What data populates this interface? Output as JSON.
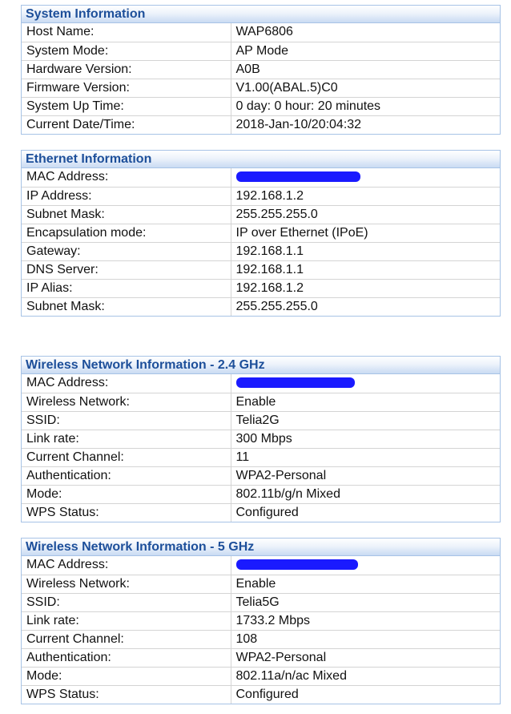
{
  "system": {
    "title": "System Information",
    "rows": [
      {
        "label": "Host Name:",
        "value": "WAP6806"
      },
      {
        "label": "System Mode:",
        "value": "AP Mode"
      },
      {
        "label": "Hardware Version:",
        "value": "A0B"
      },
      {
        "label": "Firmware Version:",
        "value": "V1.00(ABAL.5)C0"
      },
      {
        "label": "System Up Time:",
        "value": "0 day: 0 hour: 20 minutes"
      },
      {
        "label": "Current Date/Time:",
        "value": "2018-Jan-10/20:04:32"
      }
    ]
  },
  "ethernet": {
    "title": "Ethernet Information",
    "mac_label": "MAC Address:",
    "rows": [
      {
        "label": "IP Address:",
        "value": "192.168.1.2"
      },
      {
        "label": "Subnet Mask:",
        "value": "255.255.255.0"
      },
      {
        "label": "Encapsulation mode:",
        "value": "IP over Ethernet (IPoE)"
      },
      {
        "label": "Gateway:",
        "value": "192.168.1.1"
      },
      {
        "label": "DNS Server:",
        "value": "192.168.1.1"
      },
      {
        "label": "IP Alias:",
        "value": "192.168.1.2"
      },
      {
        "label": "Subnet Mask:",
        "value": "255.255.255.0"
      }
    ]
  },
  "wifi24": {
    "title": "Wireless Network Information - 2.4 GHz",
    "mac_label": "MAC Address:",
    "rows": [
      {
        "label": "Wireless Network:",
        "value": "Enable"
      },
      {
        "label": "SSID:",
        "value": "Telia2G"
      },
      {
        "label": "Link rate:",
        "value": "300 Mbps"
      },
      {
        "label": "Current Channel:",
        "value": "11"
      },
      {
        "label": "Authentication:",
        "value": "WPA2-Personal"
      },
      {
        "label": "Mode:",
        "value": "802.11b/g/n Mixed"
      },
      {
        "label": "WPS Status:",
        "value": "Configured"
      }
    ]
  },
  "wifi5": {
    "title": "Wireless Network Information - 5 GHz",
    "mac_label": "MAC Address:",
    "rows": [
      {
        "label": "Wireless Network:",
        "value": "Enable"
      },
      {
        "label": "SSID:",
        "value": "Telia5G"
      },
      {
        "label": "Link rate:",
        "value": "1733.2 Mbps"
      },
      {
        "label": "Current Channel:",
        "value": "108"
      },
      {
        "label": "Authentication:",
        "value": "WPA2-Personal"
      },
      {
        "label": "Mode:",
        "value": "802.11a/n/ac Mixed"
      },
      {
        "label": "WPS Status:",
        "value": "Configured"
      }
    ]
  },
  "colors": {
    "header_text": "#1d4f9a",
    "border": "#a7c3e6",
    "redaction": "#1a1aff"
  }
}
